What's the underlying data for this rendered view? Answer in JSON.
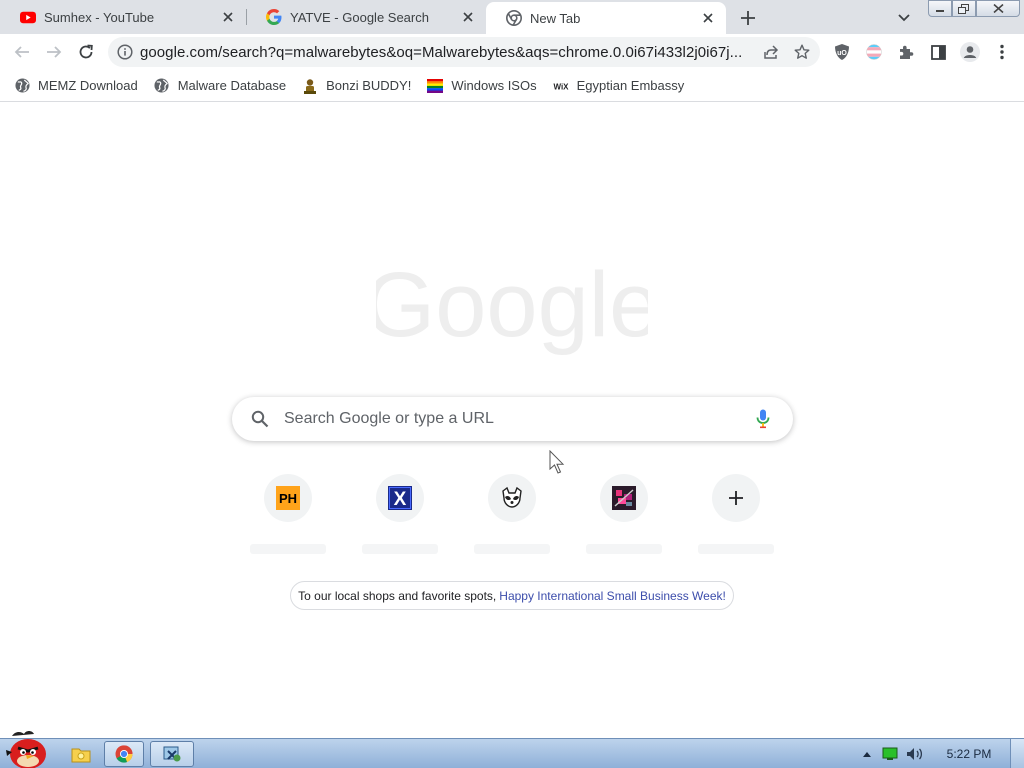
{
  "tabs": [
    {
      "label": "Sumhex - YouTube",
      "icon": "youtube-icon"
    },
    {
      "label": "YATVE - Google Search",
      "icon": "google-g-icon"
    },
    {
      "label": "New Tab",
      "icon": "chrome-icon",
      "active": true
    }
  ],
  "toolbar": {
    "url": "google.com/search?q=malwarebytes&oq=Malwarebytes&aqs=chrome.0.0i67i433l2j0i67j..."
  },
  "bookmarks": [
    {
      "label": "MEMZ Download",
      "icon": "globe-icon"
    },
    {
      "label": "Malware Database",
      "icon": "globe-icon"
    },
    {
      "label": "Bonzi BUDDY!",
      "icon": "bonzi-icon"
    },
    {
      "label": "Windows ISOs",
      "icon": "rainbow-flag-icon"
    },
    {
      "label": "Egyptian Embassy",
      "icon": "wix-icon"
    }
  ],
  "ntp": {
    "logo_text": "Google",
    "search_placeholder": "Search Google or type a URL",
    "shortcuts": [
      {
        "icon": "ph-icon",
        "text": "PH"
      },
      {
        "icon": "x-icon",
        "text": "X"
      },
      {
        "icon": "raccoon-icon"
      },
      {
        "icon": "pixel-art-icon"
      },
      {
        "icon": "add-shortcut-icon",
        "text": "+"
      }
    ],
    "promo_text": "To our local shops and favorite spots,",
    "promo_link": "Happy International Small Business Week!"
  },
  "taskbar": {
    "time": "5:22 PM"
  },
  "colors": {
    "tabstrip_bg": "#dee1e6",
    "omnibox_bg": "#f1f3f4",
    "promo_link": "#3c4dab",
    "taskbar": "#a9c3e2"
  }
}
